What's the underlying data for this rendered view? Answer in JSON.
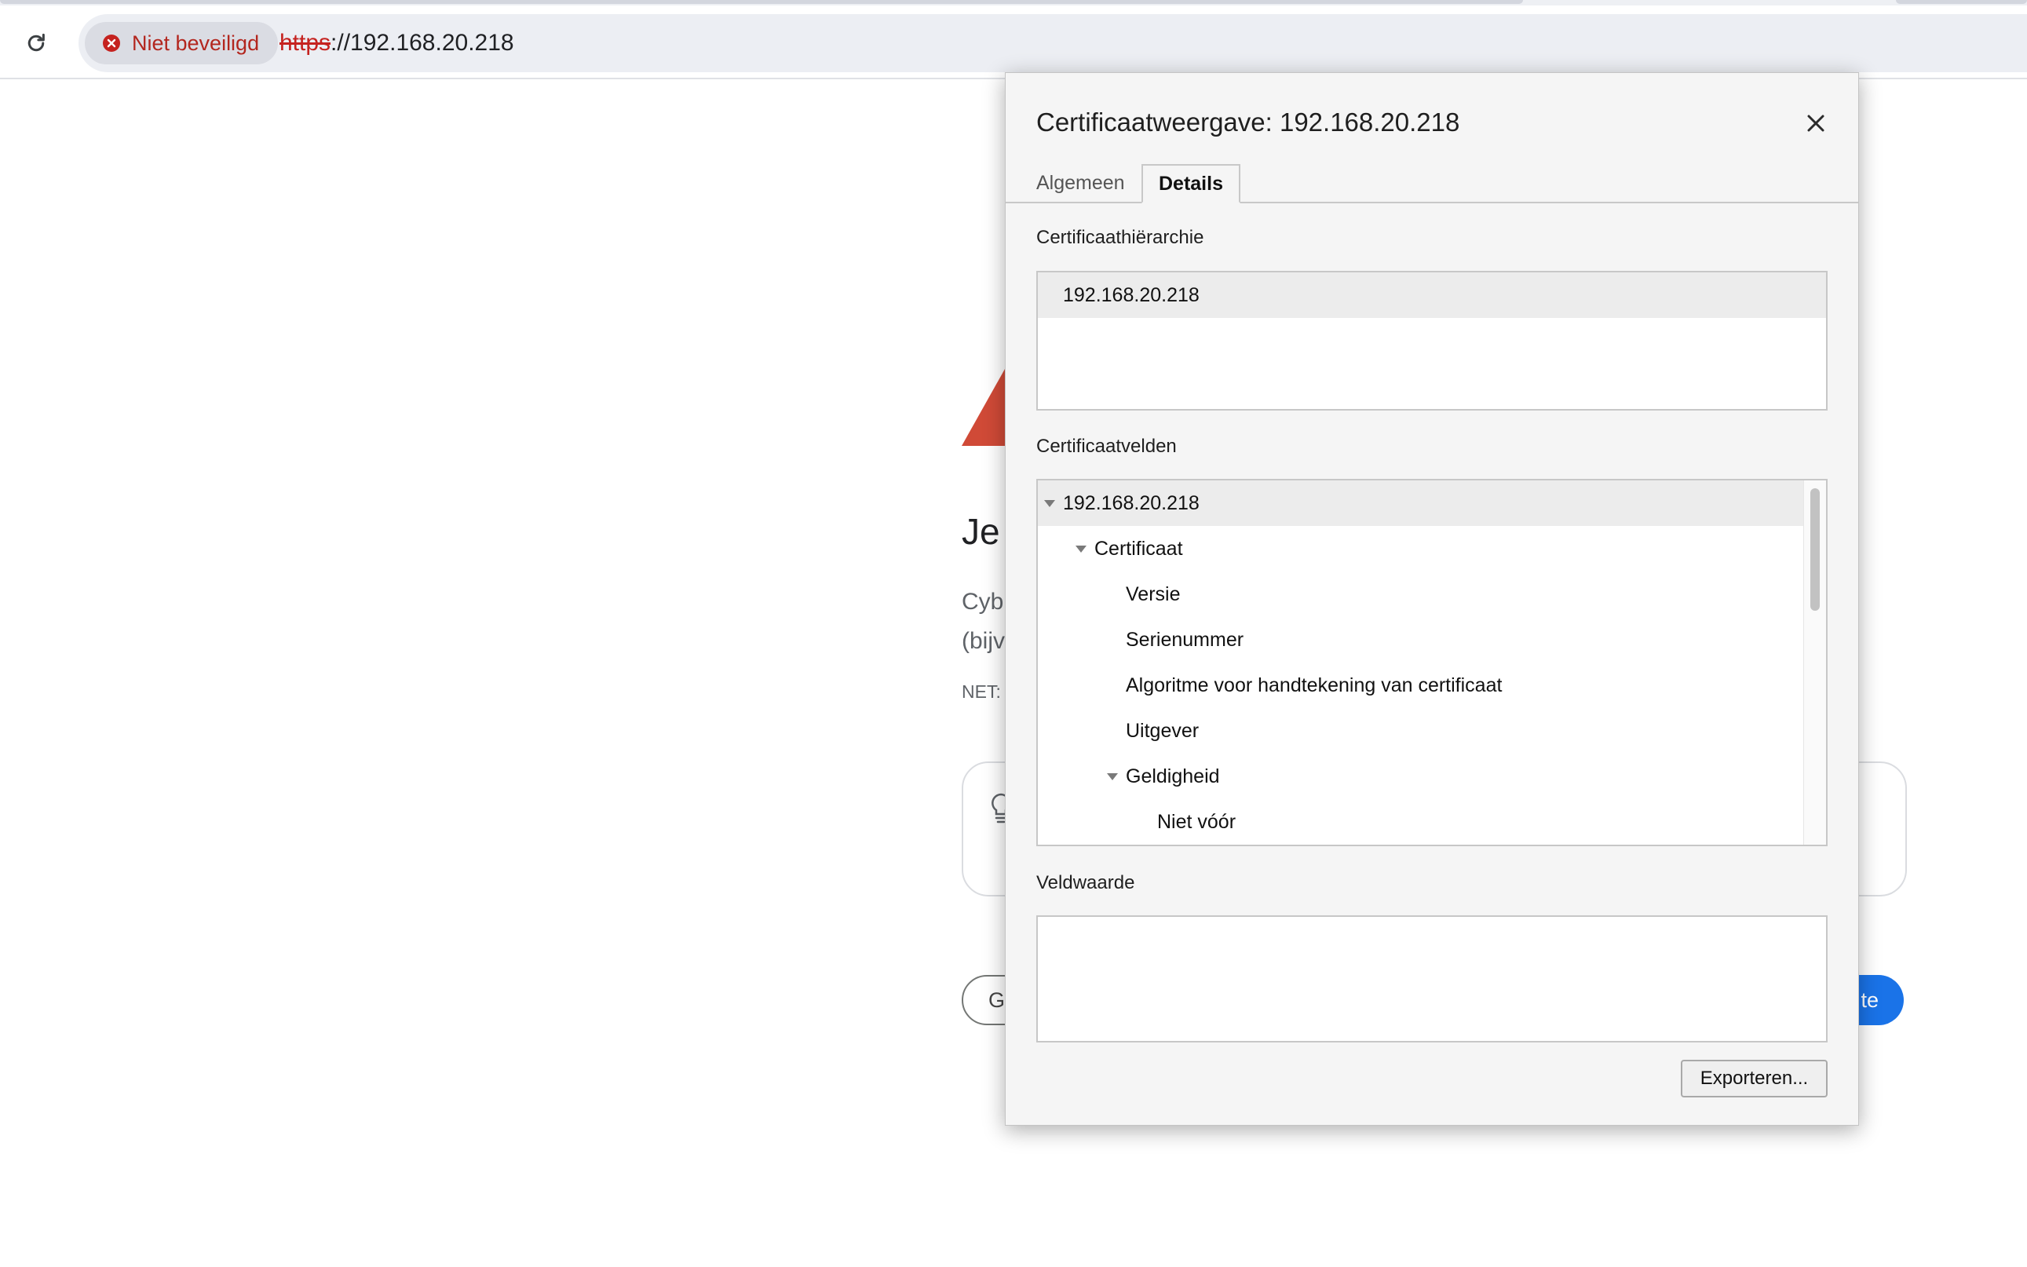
{
  "browser": {
    "security_chip": "Niet beveiligd",
    "url_scheme": "https",
    "url_rest": "://192.168.20.218",
    "colors": {
      "insecure_red": "#c5221f",
      "omnibox_bg": "#eceef3"
    }
  },
  "page": {
    "heading_fragment": "Je",
    "body_fragment_line1": "Cyb",
    "body_fragment_line2": "(bijv",
    "error_code_fragment": "NET:",
    "secondary_button_fragment": "G",
    "primary_button_fragment": "te",
    "accent_color": "#1a73e8",
    "warning_color": "#d04a37"
  },
  "dialog": {
    "title": "Certificaatweergave: 192.168.20.218",
    "tabs": [
      {
        "label": "Algemeen",
        "active": false
      },
      {
        "label": "Details",
        "active": true
      }
    ],
    "hierarchy_label": "Certificaathiërarchie",
    "hierarchy_items": [
      "192.168.20.218"
    ],
    "fields_label": "Certificaatvelden",
    "fields": [
      {
        "label": "192.168.20.218",
        "level": 0,
        "expanded": true,
        "selected": true
      },
      {
        "label": "Certificaat",
        "level": 1,
        "expanded": true
      },
      {
        "label": "Versie",
        "level": 2
      },
      {
        "label": "Serienummer",
        "level": 2
      },
      {
        "label": "Algoritme voor handtekening van certificaat",
        "level": 2
      },
      {
        "label": "Uitgever",
        "level": 2
      },
      {
        "label": "Geldigheid",
        "level": 2,
        "expanded": true
      },
      {
        "label": "Niet vóór",
        "level": 3
      }
    ],
    "value_label": "Veldwaarde",
    "field_value": "",
    "export_button": "Exporteren..."
  }
}
